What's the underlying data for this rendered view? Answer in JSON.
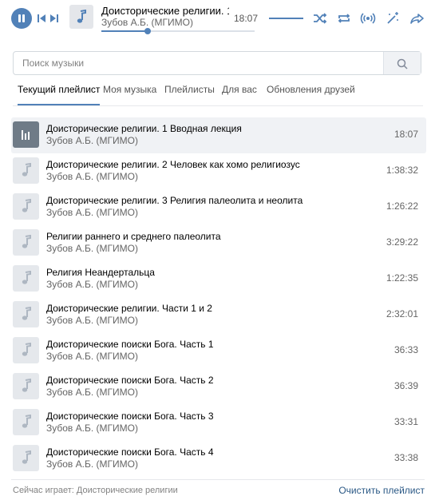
{
  "player": {
    "title": "Доисторические религии. 1 …",
    "artist": "Зубов А.Б. (МГИМО)",
    "time": "18:07",
    "progress_fraction": 0.3,
    "icons": {
      "play": "pause-icon",
      "prev": "previous-icon",
      "next": "next-icon",
      "shuffle": "shuffle-icon",
      "repeat": "repeat-icon",
      "broadcast": "broadcast-icon",
      "recommend": "magic-wand-icon",
      "share": "share-icon"
    }
  },
  "search": {
    "placeholder": "Поиск музыки",
    "value": ""
  },
  "tabs": [
    {
      "label": "Текущий плейлист",
      "active": true
    },
    {
      "label": "Моя музыка"
    },
    {
      "label": "Плейлисты"
    },
    {
      "label": "Для вас"
    },
    {
      "label": "Обновления друзей"
    }
  ],
  "tracks": [
    {
      "title": "Доисторические религии. 1 Вводная лекция",
      "artist": "Зубов А.Б. (МГИМО)",
      "duration": "18:07",
      "playing": true
    },
    {
      "title": "Доисторические религии. 2 Человек как хомо религиозус",
      "artist": "Зубов А.Б. (МГИМО)",
      "duration": "1:38:32"
    },
    {
      "title": "Доисторические религии. 3 Религия палеолита и неолита",
      "artist": "Зубов А.Б. (МГИМО)",
      "duration": "1:26:22"
    },
    {
      "title": "Религии раннего и среднего палеолита",
      "artist": "Зубов А.Б. (МГИМО)",
      "duration": "3:29:22"
    },
    {
      "title": "Религия Неандертальца",
      "artist": "Зубов А.Б. (МГИМО)",
      "duration": "1:22:35"
    },
    {
      "title": "Доисторические религии. Части 1 и 2",
      "artist": "Зубов А.Б. (МГИМО)",
      "duration": "2:32:01"
    },
    {
      "title": "Доисторические поиски Бога. Часть 1",
      "artist": "Зубов А.Б. (МГИМО)",
      "duration": "36:33"
    },
    {
      "title": "Доисторические поиски Бога. Часть 2",
      "artist": "Зубов А.Б. (МГИМО)",
      "duration": "36:39"
    },
    {
      "title": "Доисторические поиски Бога. Часть 3",
      "artist": "Зубов А.Б. (МГИМО)",
      "duration": "33:31"
    },
    {
      "title": "Доисторические поиски Бога. Часть 4",
      "artist": "Зубов А.Б. (МГИМО)",
      "duration": "33:38"
    }
  ],
  "footer": {
    "now_playing": "Сейчас играет: Доисторические религии",
    "clear_label": "Очистить плейлист"
  },
  "colors": {
    "accent": "#5181b8",
    "link": "#2a5885",
    "muted_text": "#656565",
    "current_row_bg": "#f0f2f5"
  }
}
